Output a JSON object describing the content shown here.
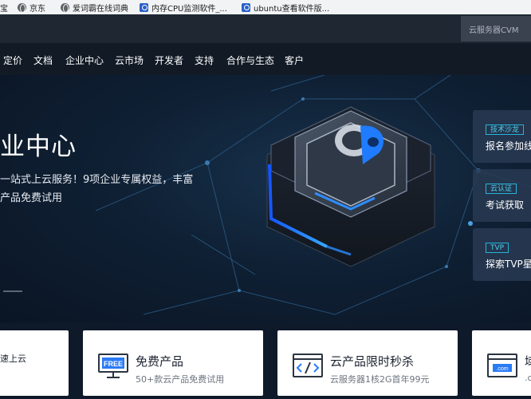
{
  "bookmarks": [
    {
      "label": "宝",
      "icon": "none"
    },
    {
      "label": "京东",
      "icon": "globe-icon"
    },
    {
      "label": "爱词霸在线词典",
      "icon": "globe-icon"
    },
    {
      "label": "内存CPU监测软件_...",
      "icon": "bookmark-icon"
    },
    {
      "label": "ubuntu查看软件版...",
      "icon": "bookmark-icon"
    }
  ],
  "header": {
    "cvm_label": "云服务器CVM"
  },
  "nav": {
    "items": [
      "定价",
      "文档",
      "企业中心",
      "云市场",
      "开发者",
      "支持",
      "合作与生态",
      "客户"
    ]
  },
  "hero": {
    "title": "业中心",
    "desc_line1": "一站式上云服务！9项企业专属权益，丰富",
    "desc_line2": "产品免费试用"
  },
  "side_cards": [
    {
      "tag": "技术沙龙",
      "text": "报名参加线"
    },
    {
      "tag": "云认证",
      "text": "考试获取"
    },
    {
      "tag": "TVP",
      "text": "探索TVP星"
    }
  ],
  "products": [
    {
      "title": "",
      "subtitle": "速上云"
    },
    {
      "title": "免费产品",
      "subtitle": "50+款云产品免费试用",
      "icon": "free-badge-icon"
    },
    {
      "title": "云产品限时秒杀",
      "subtitle": "云服务器1核2G首年99元",
      "icon": "code-window-icon"
    },
    {
      "title": "域",
      "subtitle": ".c",
      "icon": "domain-browser-icon"
    }
  ],
  "colors": {
    "accent_blue": "#1e6fff",
    "tag_cyan": "#25b5d9"
  }
}
